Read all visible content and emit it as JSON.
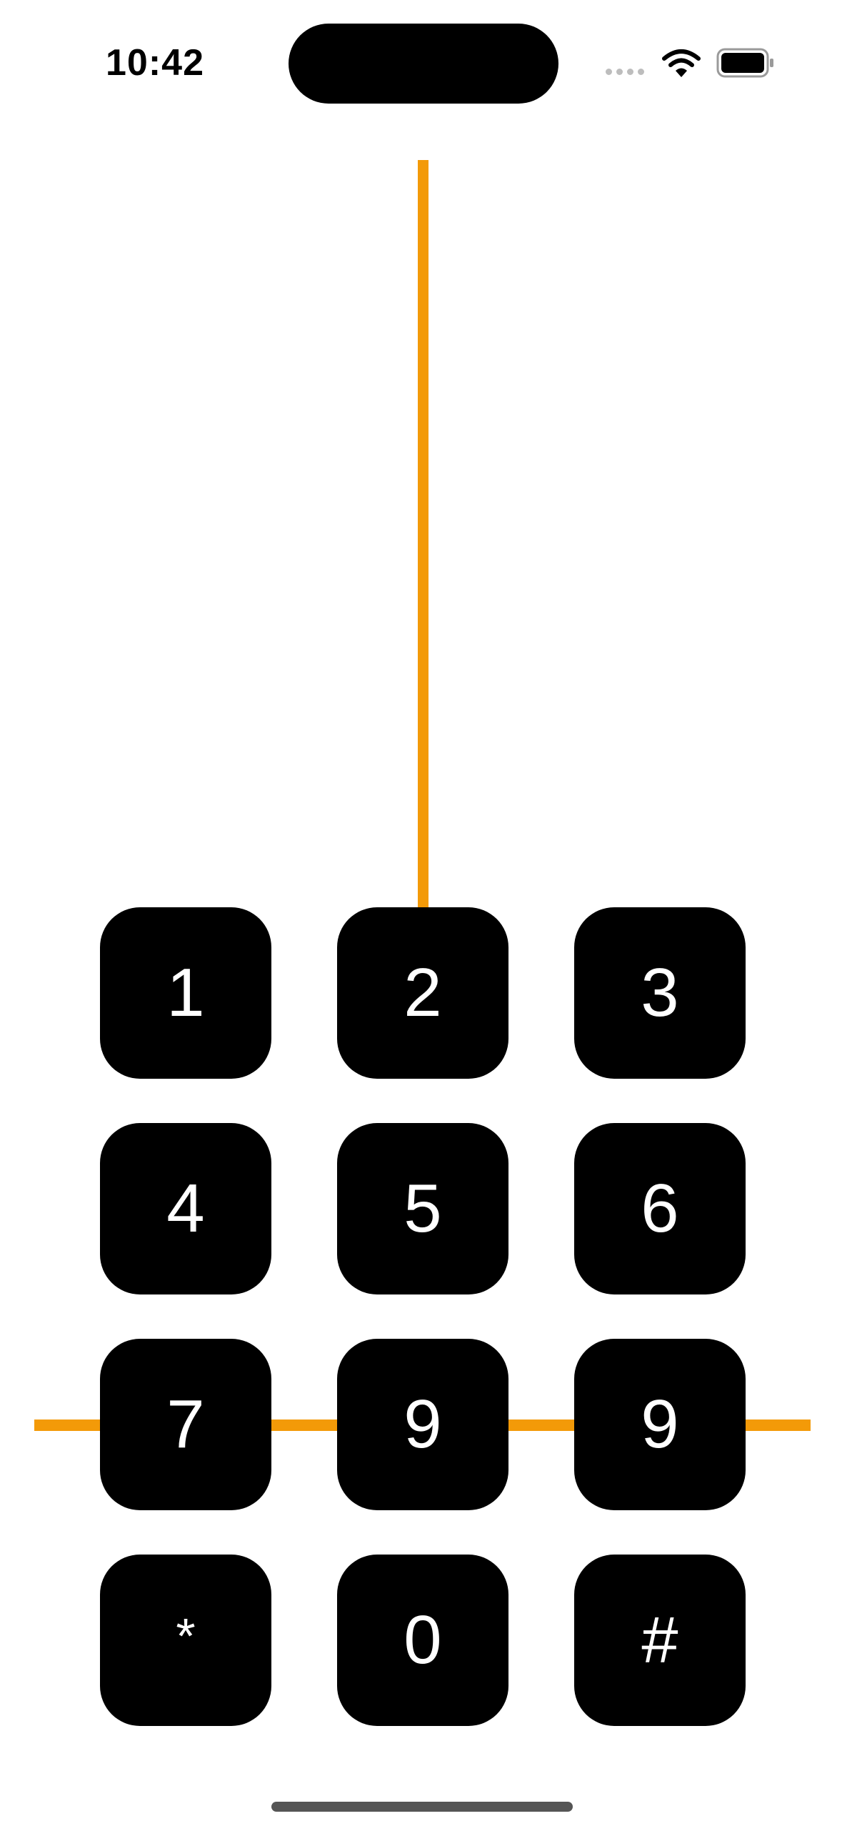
{
  "status_bar": {
    "time": "10:42",
    "icons": [
      "cellular-signal-icon",
      "wifi-icon",
      "battery-icon"
    ]
  },
  "accent_color": "#f39a08",
  "key_color": "#000000",
  "keypad": {
    "keys": [
      {
        "label": "1"
      },
      {
        "label": "2"
      },
      {
        "label": "3"
      },
      {
        "label": "4"
      },
      {
        "label": "5"
      },
      {
        "label": "6"
      },
      {
        "label": "7"
      },
      {
        "label": "9"
      },
      {
        "label": "9"
      },
      {
        "label": "*"
      },
      {
        "label": "0"
      },
      {
        "label": "#"
      }
    ]
  }
}
